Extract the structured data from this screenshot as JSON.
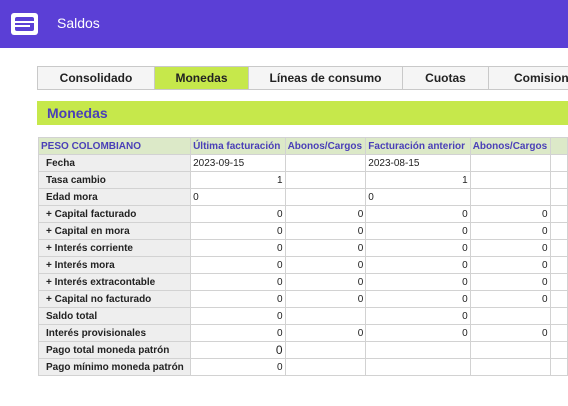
{
  "app": {
    "title": "Saldos",
    "icon": "list-icon"
  },
  "tabs": [
    {
      "label": "Consolidado",
      "active": false
    },
    {
      "label": "Monedas",
      "active": true
    },
    {
      "label": "Líneas de consumo",
      "active": false
    },
    {
      "label": "Cuotas",
      "active": false
    },
    {
      "label": "Comisione",
      "active": false
    }
  ],
  "section": {
    "title": "Monedas"
  },
  "table": {
    "headers": [
      "PESO COLOMBIANO",
      "Última facturación",
      "Abonos/Cargos",
      "Facturación anterior",
      "Abonos/Cargos"
    ],
    "rows": [
      {
        "label": "Fecha",
        "cells": [
          "2023-09-15",
          "",
          "2023-08-15",
          ""
        ]
      },
      {
        "label": "Tasa cambio",
        "cells": [
          "1",
          "",
          "1",
          ""
        ]
      },
      {
        "label": "Edad mora",
        "cells": [
          "0",
          "",
          "0",
          ""
        ]
      },
      {
        "label": "+ Capital facturado",
        "cells": [
          "0",
          "0",
          "0",
          "0"
        ]
      },
      {
        "label": "+ Capital en mora",
        "cells": [
          "0",
          "0",
          "0",
          "0"
        ]
      },
      {
        "label": "+ Interés corriente",
        "cells": [
          "0",
          "0",
          "0",
          "0"
        ]
      },
      {
        "label": "+ Interés mora",
        "cells": [
          "0",
          "0",
          "0",
          "0"
        ]
      },
      {
        "label": "+ Interés extracontable",
        "cells": [
          "0",
          "0",
          "0",
          "0"
        ]
      },
      {
        "label": "+ Capital no facturado",
        "cells": [
          "0",
          "0",
          "0",
          "0"
        ]
      },
      {
        "label": "Saldo total",
        "cells": [
          "0",
          "",
          "0",
          ""
        ]
      },
      {
        "label": "Interés provisionales",
        "cells": [
          "0",
          "0",
          "0",
          "0"
        ]
      },
      {
        "label": "Pago total moneda patrón",
        "cells": [
          "0",
          "",
          "",
          ""
        ]
      },
      {
        "label": "Pago mínimo moneda patrón",
        "cells": [
          "0",
          "",
          "",
          ""
        ]
      }
    ]
  }
}
